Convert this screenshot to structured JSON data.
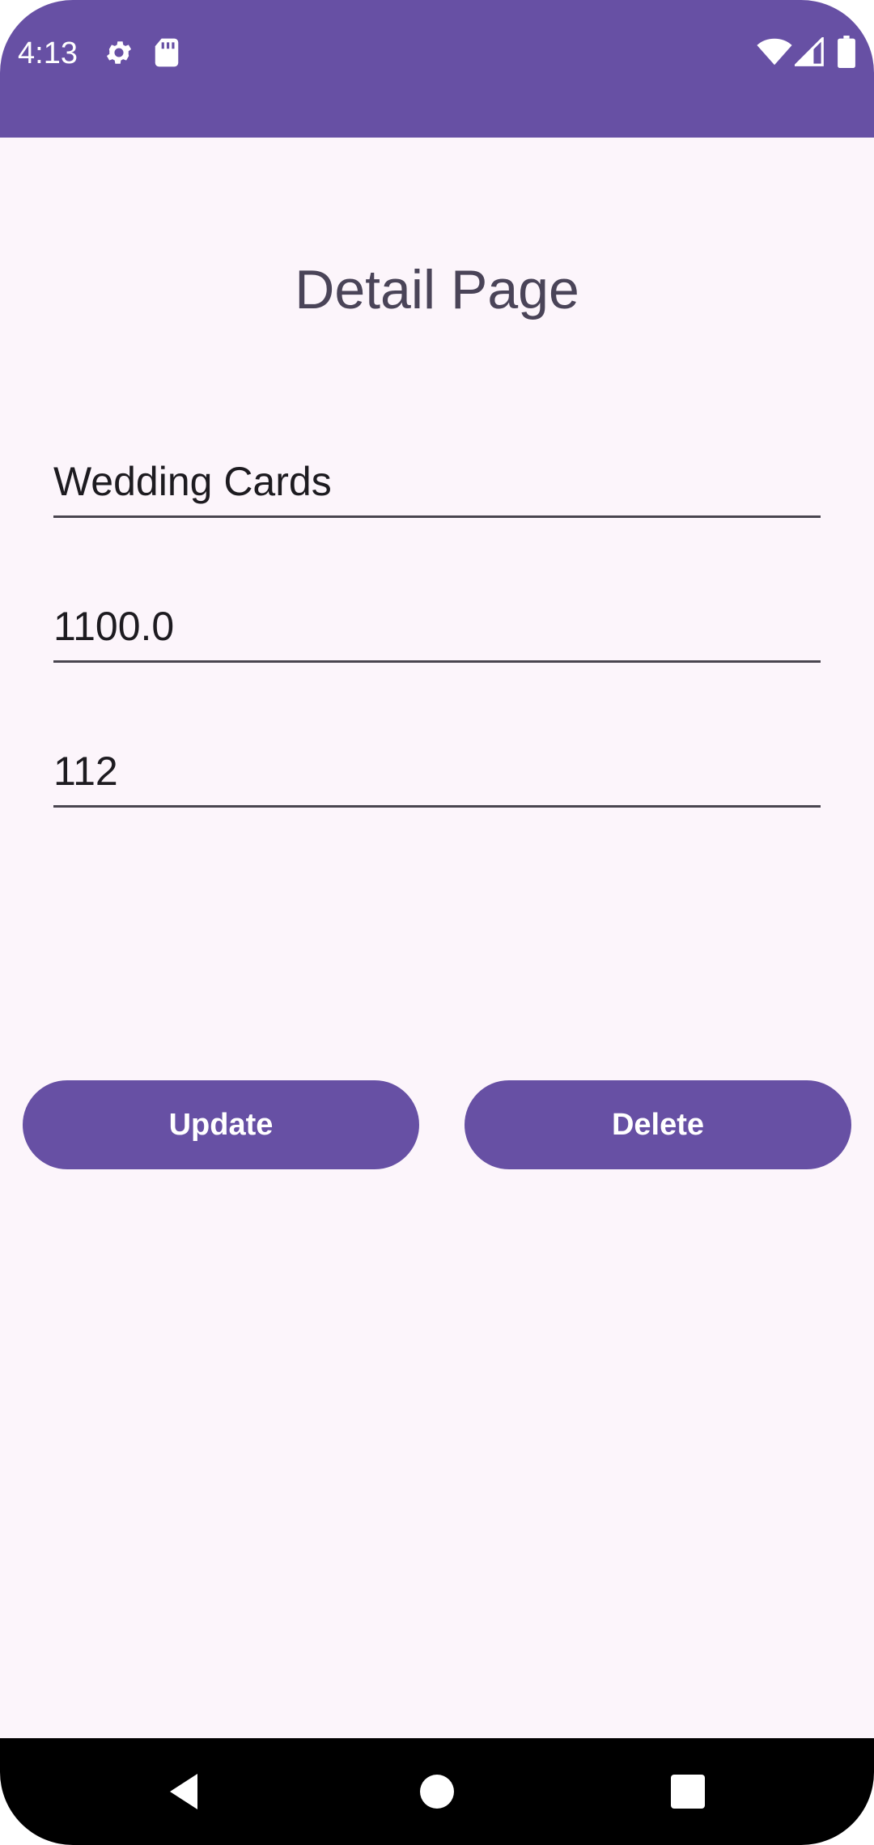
{
  "status_bar": {
    "time": "4:13",
    "icons": [
      "gear-icon",
      "sd-card-icon",
      "wifi-icon",
      "signal-icon",
      "battery-icon"
    ],
    "color": "#6750a4"
  },
  "page": {
    "title": "Detail Page"
  },
  "form": {
    "name_value": "Wedding Cards",
    "price_value": "1100.0",
    "quantity_value": "112"
  },
  "actions": {
    "update_label": "Update",
    "delete_label": "Delete",
    "button_color": "#6750a4"
  },
  "nav_bar": {
    "icons": [
      "back-icon",
      "home-icon",
      "recents-icon"
    ]
  }
}
